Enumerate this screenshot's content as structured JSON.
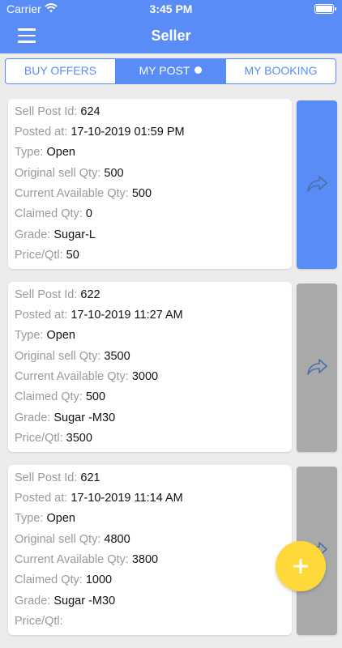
{
  "status": {
    "carrier": "Carrier",
    "time": "3:45 PM"
  },
  "nav": {
    "title": "Seller"
  },
  "tabs": [
    {
      "label": "BUY OFFERS",
      "active": false
    },
    {
      "label": "MY POST",
      "active": true
    },
    {
      "label": "MY BOOKING",
      "active": false
    }
  ],
  "labels": {
    "id": "Sell Post Id:",
    "posted": "Posted at:",
    "type": "Type:",
    "orig": "Original sell Qty:",
    "avail": "Current Available Qty:",
    "claimed": "Claimed Qty:",
    "grade": "Grade:",
    "price": "Price/Qtl:"
  },
  "posts": [
    {
      "id": "624",
      "posted": "17-10-2019 01:59 PM",
      "type": "Open",
      "orig": "500",
      "avail": "500",
      "claimed": "0",
      "grade": "Sugar-L",
      "price": "50",
      "share_color": "#5a8cf5"
    },
    {
      "id": "622",
      "posted": "17-10-2019 11:27 AM",
      "type": "Open",
      "orig": "3500",
      "avail": "3000",
      "claimed": "500",
      "grade": "Sugar -M30",
      "price": "3500",
      "share_color": "#a9a9a9"
    },
    {
      "id": "621",
      "posted": "17-10-2019 11:14 AM",
      "type": "Open",
      "orig": "4800",
      "avail": "3800",
      "claimed": "1000",
      "grade": "Sugar -M30",
      "price": "",
      "share_color": "#a9a9a9"
    }
  ],
  "colors": {
    "primary": "#5a8cf5",
    "fab": "#ffd83a"
  },
  "icons": {
    "menu": "hamburger-menu-icon",
    "share": "share-arrow-icon",
    "add": "plus-icon",
    "wifi": "wifi-icon",
    "battery": "battery-icon"
  }
}
